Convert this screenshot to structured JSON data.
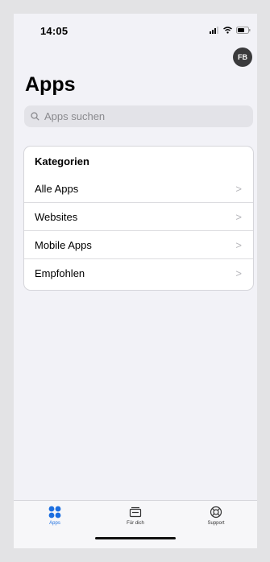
{
  "status_bar": {
    "time": "14:05"
  },
  "header": {
    "avatar_initials": "FB",
    "title": "Apps"
  },
  "search": {
    "placeholder": "Apps suchen"
  },
  "categories": {
    "title": "Kategorien",
    "items": [
      {
        "label": "Alle Apps"
      },
      {
        "label": "Websites"
      },
      {
        "label": "Mobile Apps"
      },
      {
        "label": "Empfohlen"
      }
    ]
  },
  "tabbar": {
    "tabs": [
      {
        "label": "Apps",
        "icon": "apps-grid-icon",
        "active": true
      },
      {
        "label": "Für dich",
        "icon": "inbox-stack-icon",
        "active": false
      },
      {
        "label": "Support",
        "icon": "lifebuoy-icon",
        "active": false
      }
    ]
  },
  "colors": {
    "accent": "#1d6fe0",
    "background": "#f2f2f7",
    "avatar": "#3a3a3c"
  }
}
